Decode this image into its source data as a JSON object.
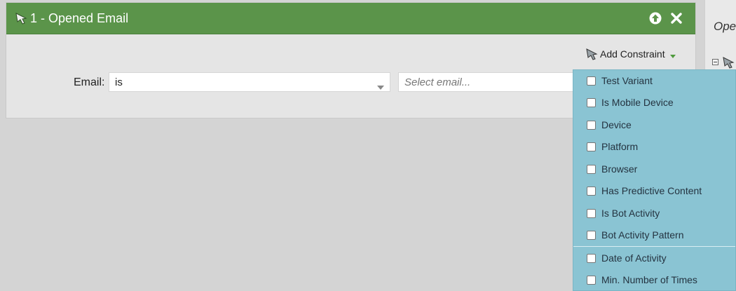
{
  "filter": {
    "title": "1 - Opened Email",
    "add_constraint_label": "Add Constraint",
    "email_label": "Email:",
    "operator_value": "is",
    "email_placeholder": "Select email..."
  },
  "right_panel": {
    "title_partial": "Ope"
  },
  "constraints": {
    "group1": [
      "Test Variant",
      "Is Mobile Device",
      "Device",
      "Platform",
      "Browser",
      "Has Predictive Content",
      "Is Bot Activity",
      "Bot Activity Pattern"
    ],
    "group2": [
      "Date of Activity",
      "Min. Number of Times"
    ]
  },
  "icons": {
    "filter": "filter-icon",
    "move_up": "arrow-up-circle-icon",
    "close": "close-icon",
    "dropdown_caret": "caret-down-icon"
  },
  "colors": {
    "header_green": "#5b944a",
    "dropdown_blue": "#8ac4d3",
    "caret_green": "#4f9a3d"
  }
}
